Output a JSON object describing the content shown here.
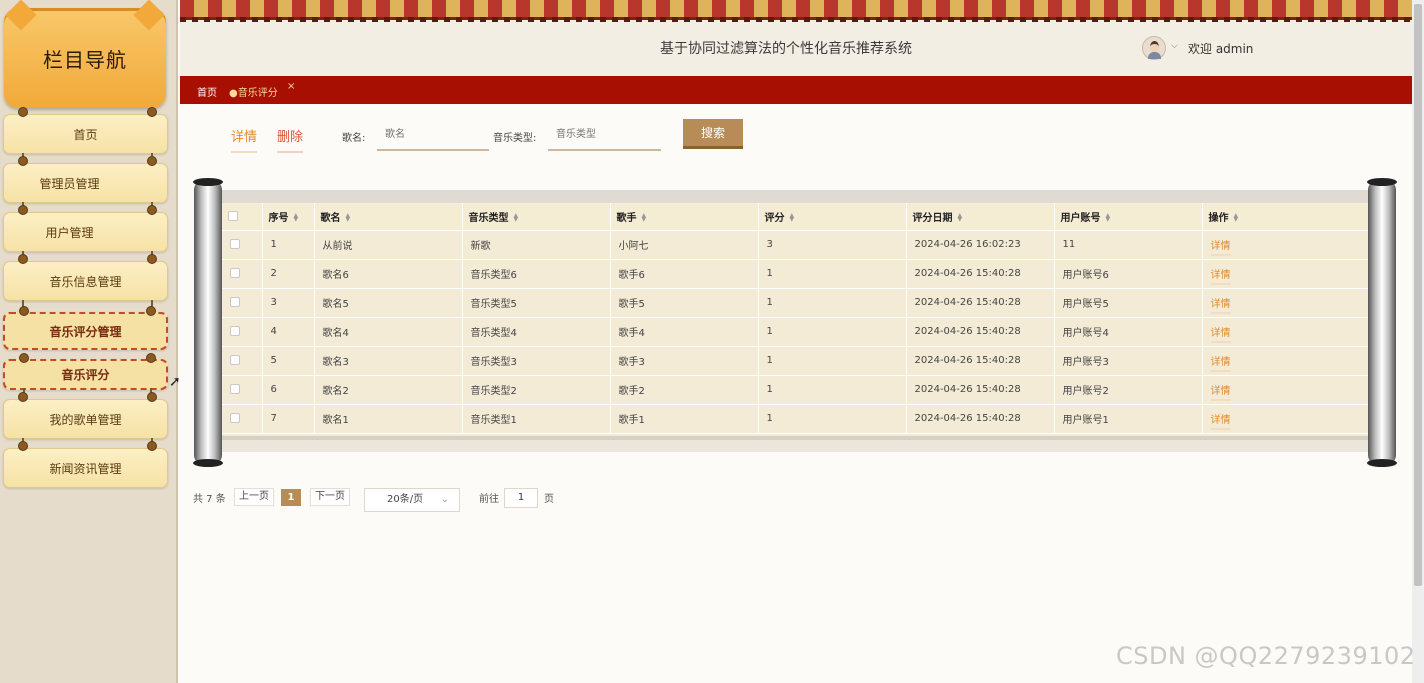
{
  "sidebar": {
    "title": "栏目导航",
    "items": [
      {
        "label": "首页"
      },
      {
        "label": "管理员管理"
      },
      {
        "label": "用户管理"
      },
      {
        "label": "音乐信息管理"
      },
      {
        "label": "音乐评分管理"
      },
      {
        "label": "音乐评分"
      },
      {
        "label": "我的歌单管理"
      },
      {
        "label": "新闻资讯管理"
      }
    ]
  },
  "header": {
    "title": "基于协同过滤算法的个性化音乐推荐系统",
    "welcome": "欢迎 admin"
  },
  "breadcrumb": {
    "home": "首页",
    "current": "●音乐评分",
    "close": "×"
  },
  "toolbar": {
    "detail_label": "详情",
    "delete_label": "删除",
    "song_label": "歌名:",
    "song_placeholder": "歌名",
    "type_label": "音乐类型:",
    "type_placeholder": "音乐类型",
    "search_label": "搜索"
  },
  "table": {
    "headers": [
      "序号",
      "歌名",
      "音乐类型",
      "歌手",
      "评分",
      "评分日期",
      "用户账号",
      "操作"
    ],
    "rows": [
      {
        "no": "1",
        "song": "从前说",
        "type": "新歌",
        "singer": "小阿七",
        "score": "3",
        "date": "2024-04-26 16:02:23",
        "user": "11",
        "action": "详情"
      },
      {
        "no": "2",
        "song": "歌名6",
        "type": "音乐类型6",
        "singer": "歌手6",
        "score": "1",
        "date": "2024-04-26 15:40:28",
        "user": "用户账号6",
        "action": "详情"
      },
      {
        "no": "3",
        "song": "歌名5",
        "type": "音乐类型5",
        "singer": "歌手5",
        "score": "1",
        "date": "2024-04-26 15:40:28",
        "user": "用户账号5",
        "action": "详情"
      },
      {
        "no": "4",
        "song": "歌名4",
        "type": "音乐类型4",
        "singer": "歌手4",
        "score": "1",
        "date": "2024-04-26 15:40:28",
        "user": "用户账号4",
        "action": "详情"
      },
      {
        "no": "5",
        "song": "歌名3",
        "type": "音乐类型3",
        "singer": "歌手3",
        "score": "1",
        "date": "2024-04-26 15:40:28",
        "user": "用户账号3",
        "action": "详情"
      },
      {
        "no": "6",
        "song": "歌名2",
        "type": "音乐类型2",
        "singer": "歌手2",
        "score": "1",
        "date": "2024-04-26 15:40:28",
        "user": "用户账号2",
        "action": "详情"
      },
      {
        "no": "7",
        "song": "歌名1",
        "type": "音乐类型1",
        "singer": "歌手1",
        "score": "1",
        "date": "2024-04-26 15:40:28",
        "user": "用户账号1",
        "action": "详情"
      }
    ]
  },
  "pagination": {
    "total": "共 7 条",
    "prev": "上一页",
    "current": "1",
    "next": "下一页",
    "page_size": "20条/页",
    "goto_label": "前往",
    "goto_value": "1",
    "page_unit": "页"
  },
  "watermark": "CSDN @QQ2279239102",
  "colors": {
    "accent": "#a70f02",
    "button": "#b78c57",
    "link": "#e08a2a"
  }
}
